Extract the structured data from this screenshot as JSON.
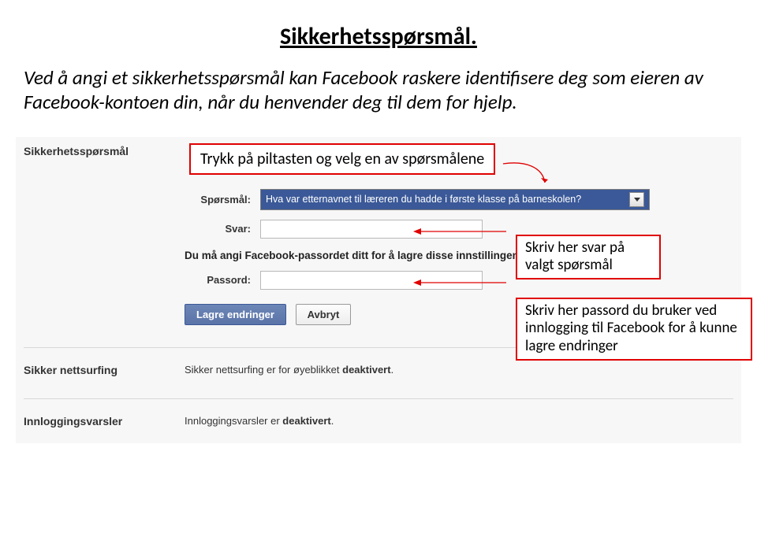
{
  "title": "Sikkerhetsspørsmål.",
  "intro": "Ved å angi et sikkerhetsspørsmål kan Facebook raskere identifisere deg som eieren av Facebook-kontoen din, når du henvender deg til dem for hjelp.",
  "section_label": "Sikkerhetsspørsmål",
  "callout_dropdown": "Trykk på piltasten og velg en av spørsmålene",
  "form": {
    "question_label": "Spørsmål:",
    "question_value": "Hva var etternavnet til læreren du hadde i første klasse på barneskolen?",
    "answer_label": "Svar:",
    "password_note": "Du må angi Facebook-passordet ditt for å lagre disse innstillingene.",
    "password_label": "Passord:",
    "save": "Lagre endringer",
    "cancel": "Avbryt"
  },
  "callout_answer": "Skriv her svar på valgt spørsmål",
  "callout_password": "Skriv her passord du bruker ved innlogging til Facebook for å kunne lagre endringer",
  "sections": {
    "safe_browsing_label": "Sikker nettsurfing",
    "safe_browsing_pre": "Sikker nettsurfing er for øyeblikket ",
    "safe_browsing_bold": "deaktivert",
    "login_alerts_label": "Innloggingsvarsler",
    "login_alerts_pre": "Innloggingsvarsler er ",
    "login_alerts_bold": "deaktivert"
  }
}
